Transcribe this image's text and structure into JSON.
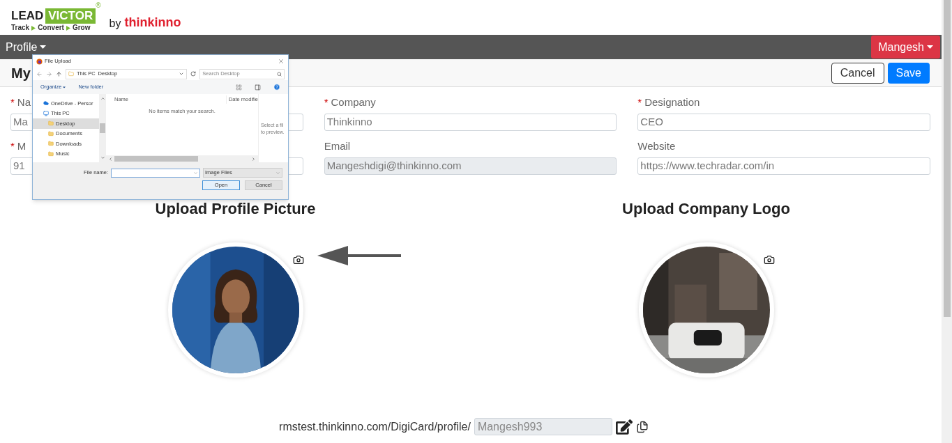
{
  "logo": {
    "brand_left": "LEAD",
    "brand_right": "VICTOR",
    "registered": "®",
    "tagline": [
      "Track",
      "Convert",
      "Grow"
    ],
    "by": "by",
    "company": "thinkinno"
  },
  "navbar": {
    "menu": "Profile",
    "user": "Mangesh"
  },
  "title_bar": {
    "title": "My",
    "buttons": [
      {
        "label": "Cancel",
        "kind": "outline"
      },
      {
        "label": "Save",
        "kind": "primary"
      }
    ]
  },
  "required_marker": "*",
  "fields": [
    {
      "label": "Na",
      "required": true,
      "value": "Ma",
      "disabled": false
    },
    {
      "label": "Company",
      "required": true,
      "value": "Thinkinno",
      "disabled": false
    },
    {
      "label": "Designation",
      "required": true,
      "value": "CEO",
      "disabled": false
    },
    {
      "label": "M",
      "required": true,
      "value": "91",
      "disabled": false
    },
    {
      "label": "Email",
      "required": false,
      "value": "Mangeshdigi@thinkinno.com",
      "disabled": true
    },
    {
      "label": "Website",
      "required": false,
      "value": "https://www.techradar.com/in",
      "disabled": false
    }
  ],
  "uploads": [
    {
      "title": "Upload Profile Picture",
      "kind": "picture"
    },
    {
      "title": "Upload Company Logo",
      "kind": "picture"
    }
  ],
  "profile_url": {
    "prefix": "rmstest.thinkinno.com/DigiCard/profile/",
    "value": "Mangesh993"
  },
  "file_dialog": {
    "title": "File Upload",
    "path": [
      "This PC",
      "Desktop"
    ],
    "search_placeholder": "Search Desktop",
    "toolbar": [
      "Organize",
      "New folder"
    ],
    "nav_items": [
      {
        "label": "OneDrive - Persor",
        "selected": false
      },
      {
        "label": "This PC",
        "selected": false,
        "children": [
          {
            "label": "Desktop",
            "selected": true
          },
          {
            "label": "Documents",
            "selected": false
          },
          {
            "label": "Downloads",
            "selected": false
          },
          {
            "label": "Music",
            "selected": false
          }
        ]
      }
    ],
    "columns": [
      "Name",
      "Date modifie"
    ],
    "empty_message": "No items match your search.",
    "preview_lines": [
      "Select a fil",
      "to preview."
    ],
    "file_name_label": "File name:",
    "file_type": "Image Files",
    "buttons": [
      {
        "label": "Open",
        "kind": "primary"
      },
      {
        "label": "Cancel",
        "kind": "normal"
      }
    ]
  }
}
